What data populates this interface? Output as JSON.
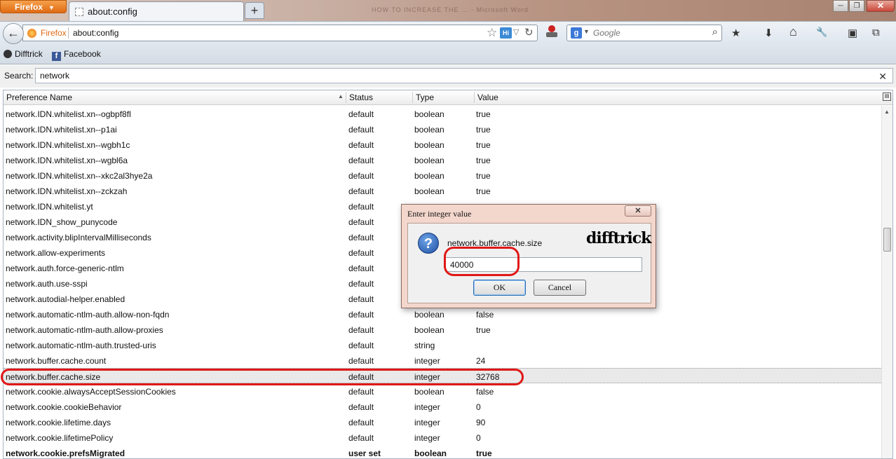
{
  "browser": {
    "menu_button_label": "Firefox",
    "menu_arrow": "▼",
    "tab_title": "about:config",
    "new_tab_symbol": "+",
    "window_title_blur": "HOW TO INCREASE THE ... - Microsoft Word",
    "window_controls": {
      "minimize": "─",
      "maximize": "❐",
      "close": "✕"
    }
  },
  "navbar": {
    "back_symbol": "←",
    "identity_label": "Firefox",
    "url": "about:config",
    "bookmark_star": "☆",
    "extension_badge": "Hi",
    "dropdown_symbol": "▽",
    "reload_symbol": "↻",
    "search_engine_letter": "g",
    "search_engine_dropdown": "▼",
    "search_placeholder": "Google",
    "search_go_symbol": "⌕",
    "icons": {
      "bookmarks_menu": "★",
      "downloads": "⬇",
      "home": "⌂",
      "tools": "🔧",
      "sidebar": "▣",
      "panorama": "⧉"
    }
  },
  "bookmarks": [
    {
      "label": "Difftrick",
      "icon": "difftrick-icon"
    },
    {
      "label": "Facebook",
      "icon": "facebook-icon"
    }
  ],
  "filter": {
    "label": "Search:",
    "value": "network",
    "clear_symbol": "✕"
  },
  "table": {
    "columns": [
      "Preference Name",
      "Status",
      "Type",
      "Value"
    ],
    "sort_indicator": "▲",
    "rows": [
      {
        "name": "network.IDN.whitelist.xn--ogbpf8fl",
        "status": "default",
        "type": "boolean",
        "value": "true"
      },
      {
        "name": "network.IDN.whitelist.xn--p1ai",
        "status": "default",
        "type": "boolean",
        "value": "true"
      },
      {
        "name": "network.IDN.whitelist.xn--wgbh1c",
        "status": "default",
        "type": "boolean",
        "value": "true"
      },
      {
        "name": "network.IDN.whitelist.xn--wgbl6a",
        "status": "default",
        "type": "boolean",
        "value": "true"
      },
      {
        "name": "network.IDN.whitelist.xn--xkc2al3hye2a",
        "status": "default",
        "type": "boolean",
        "value": "true"
      },
      {
        "name": "network.IDN.whitelist.xn--zckzah",
        "status": "default",
        "type": "boolean",
        "value": "true"
      },
      {
        "name": "network.IDN.whitelist.yt",
        "status": "default",
        "type": "",
        "value": ""
      },
      {
        "name": "network.IDN_show_punycode",
        "status": "default",
        "type": "",
        "value": ""
      },
      {
        "name": "network.activity.blipIntervalMilliseconds",
        "status": "default",
        "type": "",
        "value": ""
      },
      {
        "name": "network.allow-experiments",
        "status": "default",
        "type": "",
        "value": ""
      },
      {
        "name": "network.auth.force-generic-ntlm",
        "status": "default",
        "type": "",
        "value": ""
      },
      {
        "name": "network.auth.use-sspi",
        "status": "default",
        "type": "",
        "value": ""
      },
      {
        "name": "network.autodial-helper.enabled",
        "status": "default",
        "type": "",
        "value": ""
      },
      {
        "name": "network.automatic-ntlm-auth.allow-non-fqdn",
        "status": "default",
        "type": "boolean",
        "value": "false"
      },
      {
        "name": "network.automatic-ntlm-auth.allow-proxies",
        "status": "default",
        "type": "boolean",
        "value": "true"
      },
      {
        "name": "network.automatic-ntlm-auth.trusted-uris",
        "status": "default",
        "type": "string",
        "value": ""
      },
      {
        "name": "network.buffer.cache.count",
        "status": "default",
        "type": "integer",
        "value": "24"
      },
      {
        "name": "network.buffer.cache.size",
        "status": "default",
        "type": "integer",
        "value": "32768"
      },
      {
        "name": "network.cookie.alwaysAcceptSessionCookies",
        "status": "default",
        "type": "boolean",
        "value": "false"
      },
      {
        "name": "network.cookie.cookieBehavior",
        "status": "default",
        "type": "integer",
        "value": "0"
      },
      {
        "name": "network.cookie.lifetime.days",
        "status": "default",
        "type": "integer",
        "value": "90"
      },
      {
        "name": "network.cookie.lifetimePolicy",
        "status": "default",
        "type": "integer",
        "value": "0"
      },
      {
        "name": "network.cookie.prefsMigrated",
        "status": "user set",
        "type": "boolean",
        "value": "true"
      }
    ]
  },
  "dialog": {
    "title": "Enter integer value",
    "close_symbol": "✕",
    "question_symbol": "?",
    "message": "network.buffer.cache.size",
    "input_value": "40000",
    "watermark": "difftrick",
    "ok_label": "OK",
    "cancel_label": "Cancel"
  }
}
